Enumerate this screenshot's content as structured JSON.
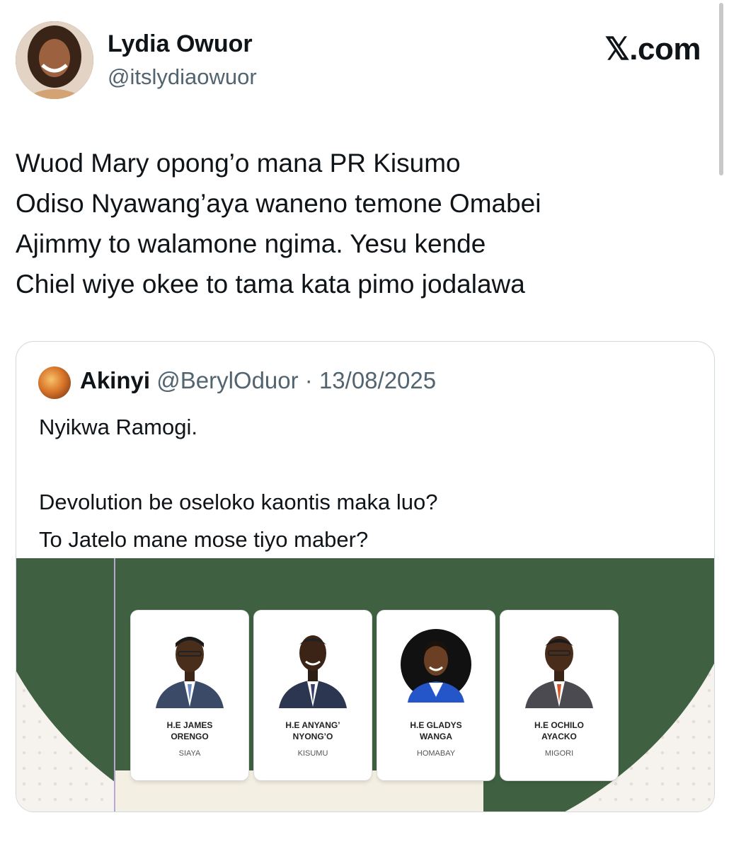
{
  "brand": "𝕏.com",
  "author": {
    "name": "Lydia Owuor",
    "handle": "@itslydiaowuor"
  },
  "tweet": {
    "lines": [
      "Wuod Mary opong’o mana PR Kisumo",
      "Odiso Nyawang’aya waneno temone Omabei",
      "Ajimmy to walamone ngima. Yesu kende",
      "Chiel wiye okee to tama kata pimo jodalawa"
    ]
  },
  "quote": {
    "name": "Akinyi",
    "meta": "@BerylOduor · 13/08/2025",
    "lines": [
      "Nyikwa Ramogi.",
      "",
      "Devolution be oseloko kaontis maka luo?",
      "To Jatelo mane mose tiyo maber?"
    ]
  },
  "cards": [
    {
      "name_line1": "H.E JAMES",
      "name_line2": "ORENGO",
      "county": "SIAYA"
    },
    {
      "name_line1": "H.E ANYANG’",
      "name_line2": "NYONG’O",
      "county": "KISUMU"
    },
    {
      "name_line1": "H.E GLADYS",
      "name_line2": "WANGA",
      "county": "HOMABAY"
    },
    {
      "name_line1": "H.E OCHILO",
      "name_line2": "AYACKO",
      "county": "MIGORI"
    }
  ],
  "colors": {
    "banner_green": "#3f6141",
    "handle_gray": "#536471",
    "border": "#cfd9de"
  }
}
